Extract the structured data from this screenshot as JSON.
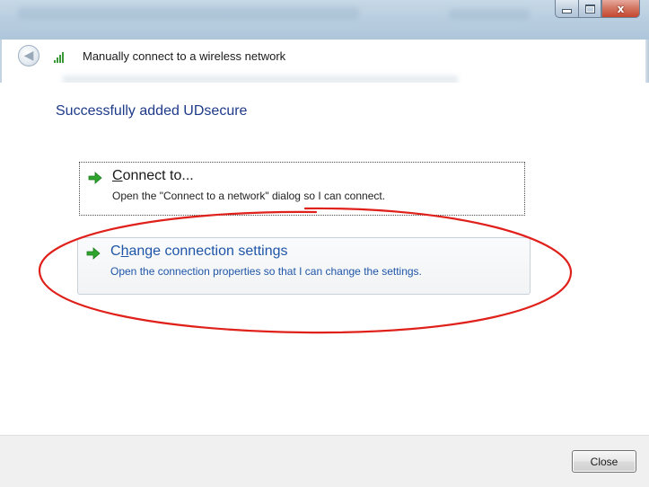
{
  "window": {
    "header_title": "Manually connect to a wireless network",
    "caption": {
      "close_glyph": "x"
    }
  },
  "content": {
    "heading": "Successfully added UDsecure",
    "options": [
      {
        "main_before": "",
        "accel": "C",
        "main_after": "onnect to...",
        "description": "Open the \"Connect to a network\" dialog so I can connect.",
        "state": "focused"
      },
      {
        "main_before": "C",
        "accel": "h",
        "main_after": "ange connection settings",
        "description": "Open the connection properties so that I can change the settings.",
        "state": "hover"
      }
    ]
  },
  "footer": {
    "close_label": "Close"
  },
  "colors": {
    "heading": "#1e3a8a",
    "link_hover": "#1f55a8",
    "arrow_green": "#2fa52f",
    "annotation_red": "#e0201a"
  },
  "icons": {
    "back": "back-arrow-icon",
    "signal": "wireless-signal-icon",
    "option_arrow": "green-arrow-icon"
  }
}
